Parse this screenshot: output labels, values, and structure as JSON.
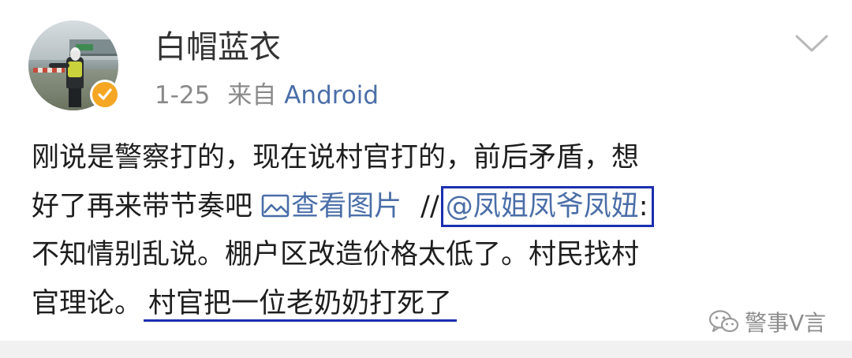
{
  "post": {
    "author_name": "白帽蓝衣",
    "time": "1-25",
    "source_prefix": "来自",
    "source_name": "Android",
    "verified_badge": "yellow-verified",
    "accent_link_color": "#4a6ea8",
    "highlight_color": "#1a2fb0",
    "body": {
      "line1": "刚说是警察打的，现在说村官打的，前后矛盾，想",
      "line2_text": "好了再来带节奏吧",
      "view_image_label": "查看图片",
      "forward_sep": "//",
      "mention": "@凤姐凤爷凤妞",
      "mention_colon": ":",
      "line3": "不知情别乱说。棚户区改造价格太低了。村民找村",
      "line4_text": "官理论。",
      "line4_underlined": "村官把一位老奶奶打死了"
    }
  },
  "watermark": {
    "text": "警事V言",
    "icon": "wechat-icon"
  }
}
